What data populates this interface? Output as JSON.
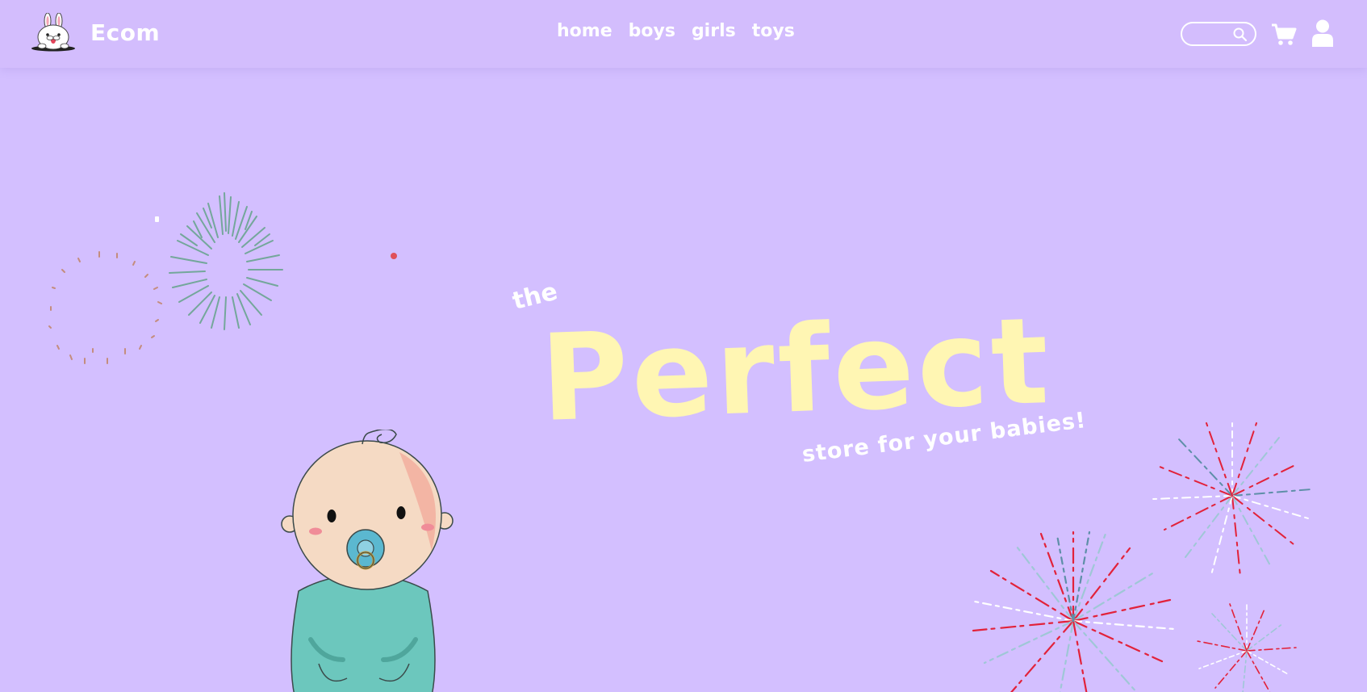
{
  "brand": {
    "name": "Ecom",
    "logo_icon": "bunny-logo-icon"
  },
  "nav": {
    "links": [
      {
        "label": "home"
      },
      {
        "label": "boys"
      },
      {
        "label": "girls"
      },
      {
        "label": "toys"
      }
    ]
  },
  "search": {
    "value": "",
    "placeholder": "",
    "icon": "search-icon"
  },
  "header_icons": {
    "cart": "cart-icon",
    "user": "user-icon"
  },
  "hero": {
    "pre_title": "the",
    "title": "Perfect",
    "tagline": "store for your babies!",
    "illustration": "baby-illustration",
    "decorations": [
      "fireworks-green",
      "fireworks-dotted-ring",
      "fireworks-red-blue"
    ]
  },
  "colors": {
    "background": "#d3bfff",
    "title": "#fff6b3",
    "text": "#ffffff",
    "baby_body": "#6cc7bd",
    "baby_skin": "#f5dac4",
    "pacifier": "#5bb8d0",
    "firework_red": "#e2223a",
    "firework_teal": "#6fa89a"
  }
}
